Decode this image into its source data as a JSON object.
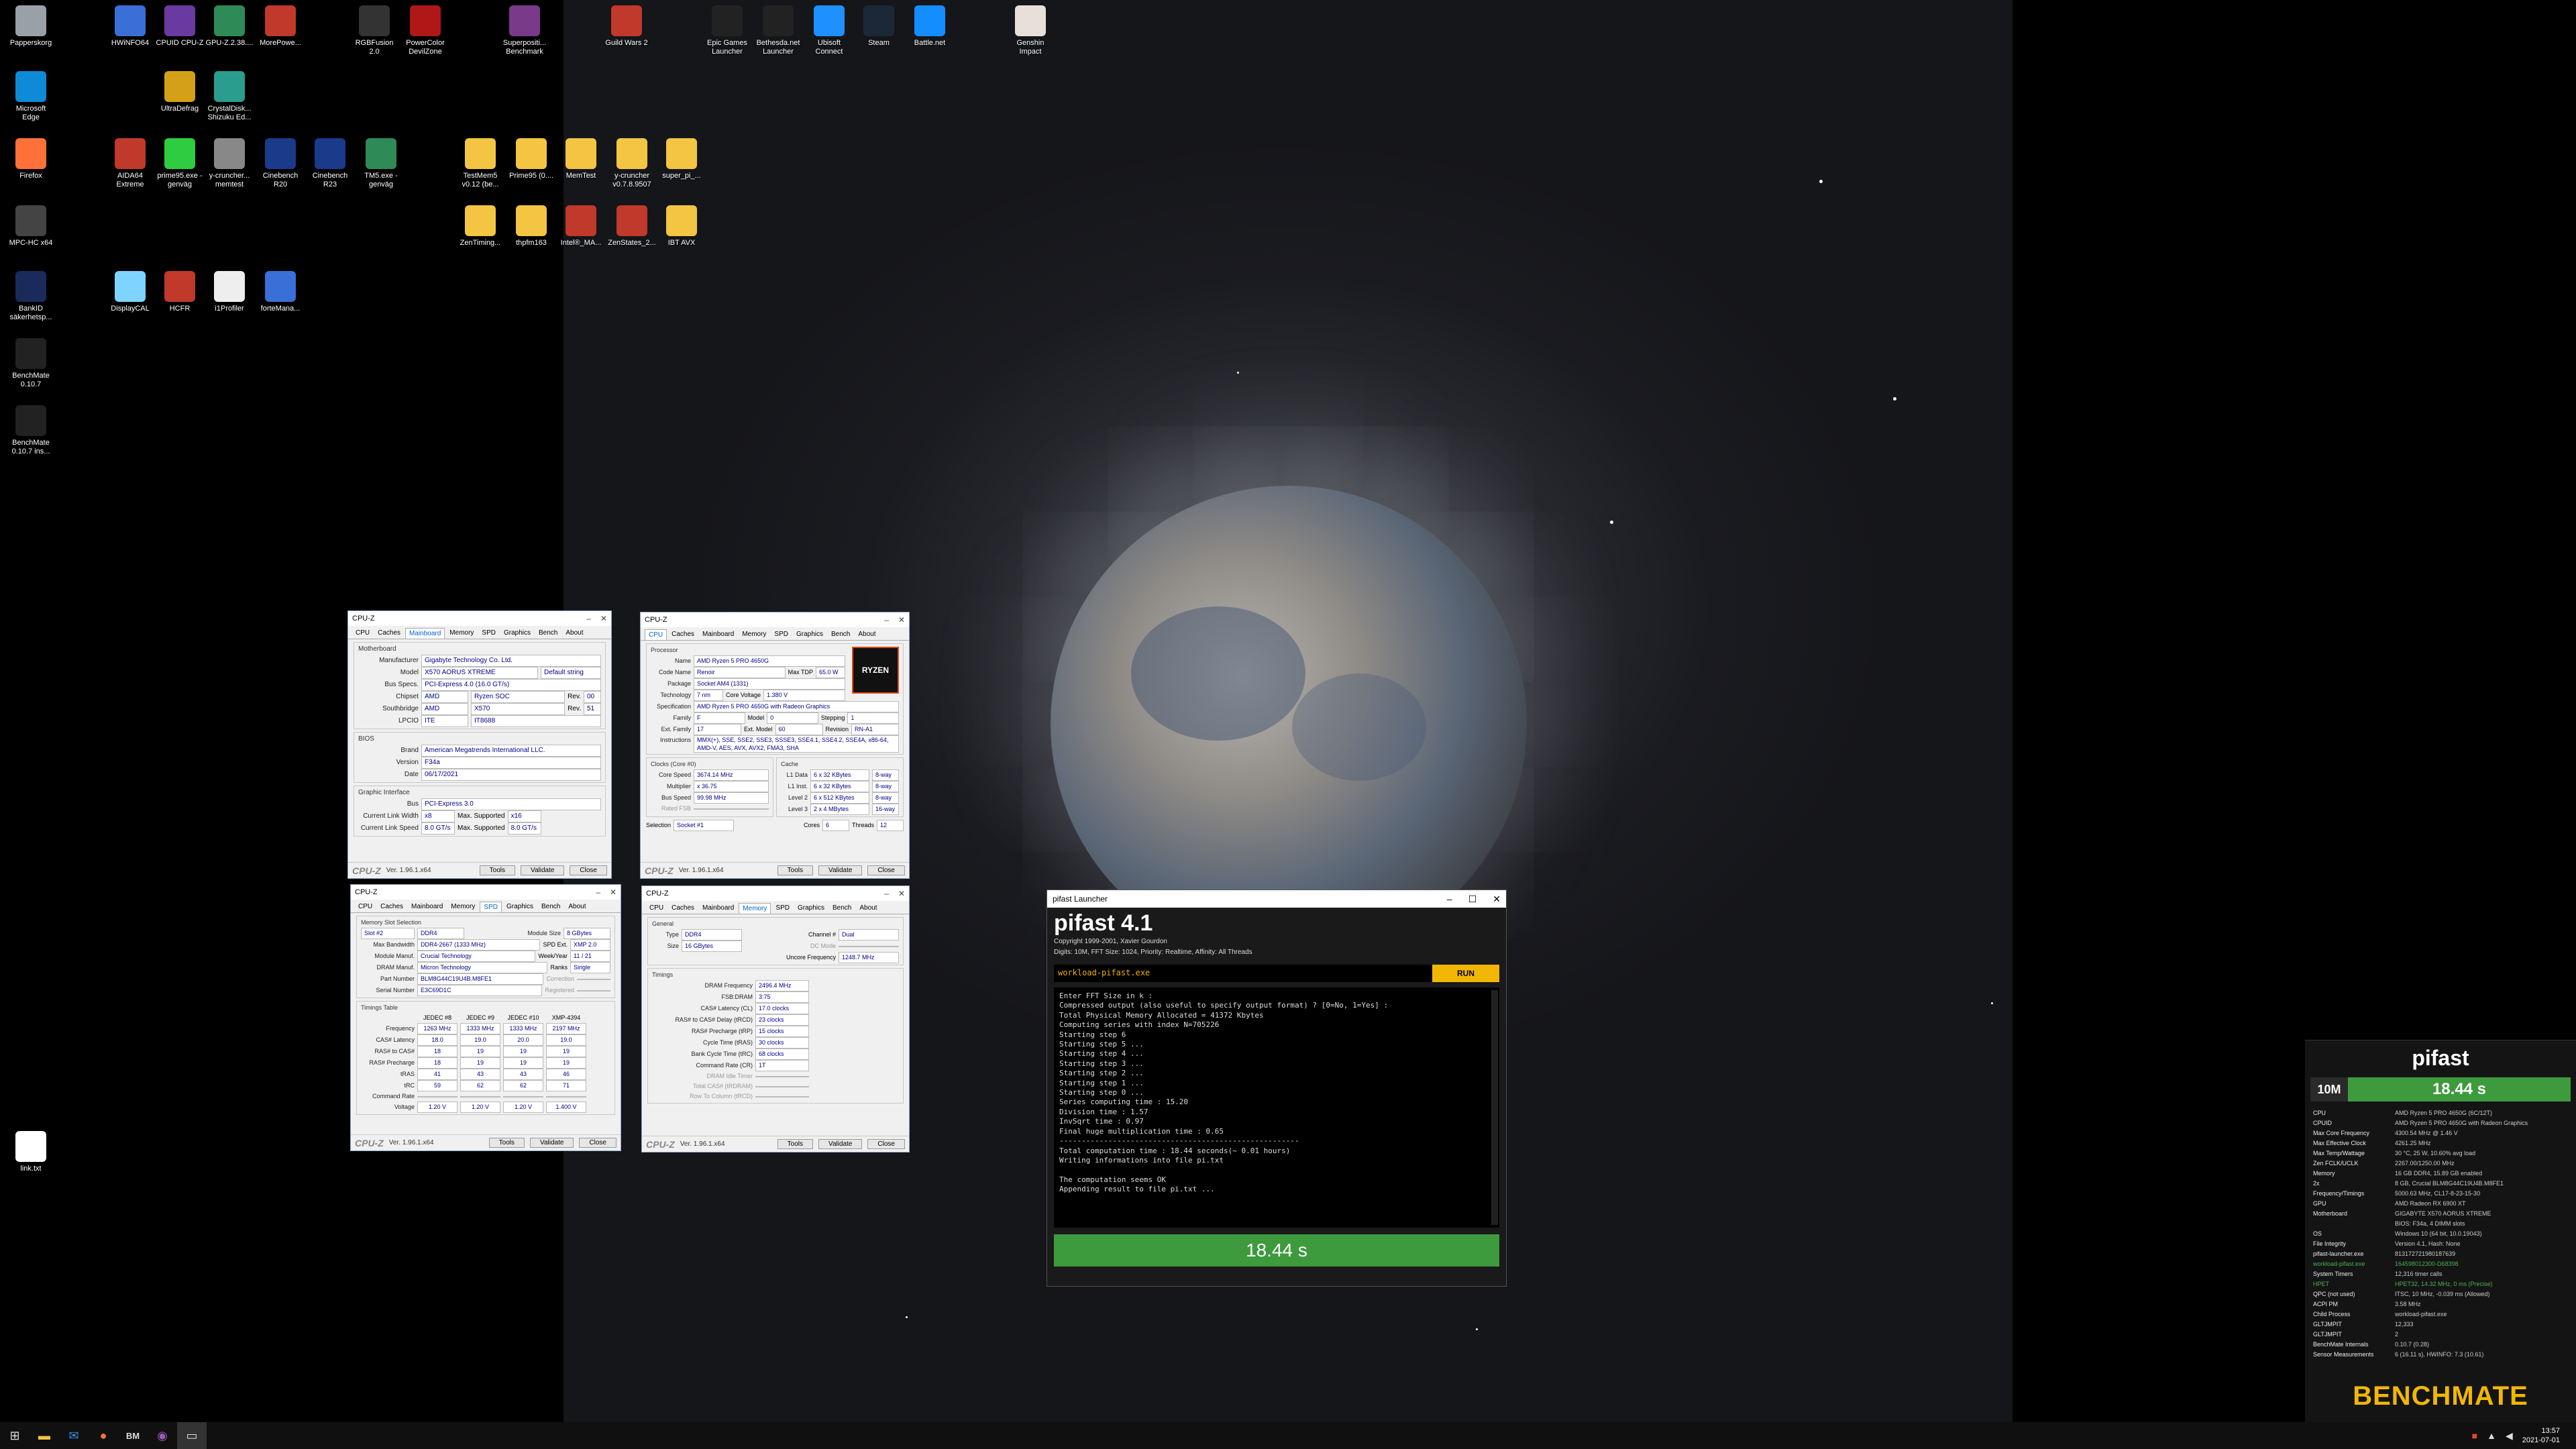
{
  "desktop": {
    "icons": [
      {
        "label": "Papperskorg",
        "color": "#9aa0a8"
      },
      {
        "label": "HWiNFO64",
        "color": "#3a6fd8"
      },
      {
        "label": "CPUID CPU-Z",
        "color": "#6a3aa0"
      },
      {
        "label": "GPU-Z.2.38....",
        "color": "#2e8b57"
      },
      {
        "label": "MorePowe...",
        "color": "#c0392b"
      },
      {
        "label": "RGBFusion 2.0",
        "color": "#333"
      },
      {
        "label": "PowerColor DevilZone",
        "color": "#b01818"
      },
      {
        "label": "Superpositi... Benchmark",
        "color": "#7a3a8a"
      },
      {
        "label": "Guild Wars 2",
        "color": "#c0392b"
      },
      {
        "label": "Epic Games Launcher",
        "color": "#222"
      },
      {
        "label": "Bethesda.net Launcher",
        "color": "#222"
      },
      {
        "label": "Ubisoft Connect",
        "color": "#1e90ff"
      },
      {
        "label": "Steam",
        "color": "#1b2838"
      },
      {
        "label": "Battle.net",
        "color": "#148eff"
      },
      {
        "label": "Genshin Impact",
        "color": "#e8e0d8"
      },
      {
        "label": "Microsoft Edge",
        "color": "#0f8ad6"
      },
      {
        "label": "UltraDefrag",
        "color": "#d4a017"
      },
      {
        "label": "CrystalDisk... Shizuku Ed...",
        "color": "#2a9d8f"
      },
      {
        "label": "Firefox",
        "color": "#ff7139"
      },
      {
        "label": "AIDA64 Extreme",
        "color": "#c0392b"
      },
      {
        "label": "prime95.exe - genväg",
        "color": "#2ecc40"
      },
      {
        "label": "y-cruncher... memtest",
        "color": "#888"
      },
      {
        "label": "Cinebench R20",
        "color": "#1a3a8a"
      },
      {
        "label": "Cinebench R23",
        "color": "#1a3a8a"
      },
      {
        "label": "TM5.exe - genväg",
        "color": "#2e8b57"
      },
      {
        "label": "TestMem5 v0.12 (be...",
        "color": "#f4c542"
      },
      {
        "label": "Prime95 (0....",
        "color": "#f4c542"
      },
      {
        "label": "MemTest",
        "color": "#f4c542"
      },
      {
        "label": "y-cruncher v0.7.8.9507",
        "color": "#f4c542"
      },
      {
        "label": "super_pi_...",
        "color": "#f4c542"
      },
      {
        "label": "MPC-HC x64",
        "color": "#444"
      },
      {
        "label": "ZenTiming...",
        "color": "#f4c542"
      },
      {
        "label": "thpfm163",
        "color": "#f4c542"
      },
      {
        "label": "Intel®_MA...",
        "color": "#c0392b"
      },
      {
        "label": "ZenStates_2...",
        "color": "#c0392b"
      },
      {
        "label": "IBT AVX",
        "color": "#f4c542"
      },
      {
        "label": "BankID säkerhetsp...",
        "color": "#1a2a5a"
      },
      {
        "label": "DisplayCAL",
        "color": "#7fd4ff"
      },
      {
        "label": "HCFR",
        "color": "#c0392b"
      },
      {
        "label": "i1Profiler",
        "color": "#eee"
      },
      {
        "label": "forteMana...",
        "color": "#3a6fd8"
      },
      {
        "label": "BenchMate 0.10.7",
        "color": "#222"
      },
      {
        "label": "BenchMate 0.10.7 ins...",
        "color": "#222"
      },
      {
        "label": "link.txt",
        "color": "#fff"
      }
    ]
  },
  "cpuz_mb": {
    "title": "CPU-Z",
    "tabs": [
      "CPU",
      "Caches",
      "Mainboard",
      "Memory",
      "SPD",
      "Graphics",
      "Bench",
      "About"
    ],
    "group_mb": "Motherboard",
    "manufacturer_k": "Manufacturer",
    "manufacturer": "Gigabyte Technology Co. Ltd.",
    "model_k": "Model",
    "model": "X570 AORUS XTREME",
    "model2": "Default string",
    "busspecs_k": "Bus Specs.",
    "busspecs": "PCI-Express 4.0 (16.0 GT/s)",
    "chipset_k": "Chipset",
    "chipset_a": "AMD",
    "chipset_b": "Ryzen SOC",
    "chipset_rev": "00",
    "south_k": "Southbridge",
    "south_a": "AMD",
    "south_b": "X570",
    "south_rev": "51",
    "lpcio_k": "LPCIO",
    "lpcio_a": "ITE",
    "lpcio_b": "IT8688",
    "group_bios": "BIOS",
    "brand_k": "Brand",
    "brand": "American Megatrends International LLC.",
    "version_k": "Version",
    "version": "F34a",
    "date_k": "Date",
    "date": "06/17/2021",
    "group_gi": "Graphic Interface",
    "bus_k": "Bus",
    "bus": "PCI-Express 3.0",
    "clw_k": "Current Link Width",
    "clw": "x8",
    "msup_k": "Max. Supported",
    "msup": "x16",
    "cls_k": "Current Link Speed",
    "cls": "8.0 GT/s",
    "msup2": "8.0 GT/s",
    "rev_label": "Rev.",
    "logo": "CPU-Z",
    "ver": "Ver. 1.96.1.x64",
    "tools": "Tools",
    "validate": "Validate",
    "close": "Close"
  },
  "cpuz_cpu": {
    "title": "CPU-Z",
    "tabs": [
      "CPU",
      "Caches",
      "Mainboard",
      "Memory",
      "SPD",
      "Graphics",
      "Bench",
      "About"
    ],
    "group_proc": "Processor",
    "name_k": "Name",
    "name": "AMD Ryzen 5 PRO 4650G",
    "code_k": "Code Name",
    "code": "Renoir",
    "tdp_k": "Max TDP",
    "tdp": "65.0 W",
    "pkg_k": "Package",
    "pkg": "Socket AM4 (1331)",
    "tech_k": "Technology",
    "tech": "7 nm",
    "cv_k": "Core Voltage",
    "cv": "1.380 V",
    "spec_k": "Specification",
    "spec": "AMD Ryzen 5 PRO 4650G with Radeon Graphics",
    "fam_k": "Family",
    "fam": "F",
    "model_k": "Model",
    "model": "0",
    "step_k": "Stepping",
    "step": "1",
    "extfam_k": "Ext. Family",
    "extfam": "17",
    "extmod_k": "Ext. Model",
    "extmod": "60",
    "rev_k": "Revision",
    "rev": "RN-A1",
    "instr_k": "Instructions",
    "instr": "MMX(+), SSE, SSE2, SSE3, SSSE3, SSE4.1, SSE4.2, SSE4A, x86-64, AMD-V, AES, AVX, AVX2, FMA3, SHA",
    "group_clk": "Clocks (Core #0)",
    "cs_k": "Core Speed",
    "cs": "3674.14 MHz",
    "mul_k": "Multiplier",
    "mul": "x 36.75",
    "bus_k": "Bus Speed",
    "bus": "99.98 MHz",
    "fsb_k": "Rated FSB",
    "group_cache": "Cache",
    "l1d_k": "L1 Data",
    "l1d": "6 x 32 KBytes",
    "l1d_w": "8-way",
    "l1i_k": "L1 Inst.",
    "l1i": "6 x 32 KBytes",
    "l1i_w": "8-way",
    "l2_k": "Level 2",
    "l2": "6 x 512 KBytes",
    "l2_w": "8-way",
    "l3_k": "Level 3",
    "l3": "2 x 4 MBytes",
    "l3_w": "16-way",
    "sel_k": "Selection",
    "sel": "Socket #1",
    "cores_k": "Cores",
    "cores": "6",
    "threads_k": "Threads",
    "threads": "12",
    "badge": "RYZEN",
    "logo": "CPU-Z",
    "ver": "Ver. 1.96.1.x64",
    "tools": "Tools",
    "validate": "Validate",
    "close": "Close"
  },
  "cpuz_spd": {
    "title": "CPU-Z",
    "tabs": [
      "CPU",
      "Caches",
      "Mainboard",
      "Memory",
      "SPD",
      "Graphics",
      "Bench",
      "About"
    ],
    "group": "Memory Slot Selection",
    "slot": "Slot #2",
    "type": "DDR4",
    "msize_k": "Module Size",
    "msize": "8 GBytes",
    "mbw_k": "Max Bandwidth",
    "mbw": "DDR4-2667 (1333 MHz)",
    "spdext_k": "SPD Ext.",
    "spdext": "XMP 2.0",
    "manuf_k": "Module Manuf.",
    "manuf": "Crucial Technology",
    "wy_k": "Week/Year",
    "wy": "11 / 21",
    "dram_k": "DRAM Manuf.",
    "dram": "Micron Technology",
    "ranks_k": "Ranks",
    "ranks": "Single",
    "pn_k": "Part Number",
    "pn": "BLM8G44C19U4B.M8FE1",
    "corr_k": "Correction",
    "sn_k": "Serial Number",
    "sn": "E3C69D1C",
    "reg_k": "Registered",
    "tt": "Timings Table",
    "cols": [
      "JEDEC #8",
      "JEDEC #9",
      "JEDEC #10",
      "XMP-4394"
    ],
    "rows": [
      [
        "Frequency",
        "1263 MHz",
        "1333 MHz",
        "1333 MHz",
        "2197 MHz"
      ],
      [
        "CAS# Latency",
        "18.0",
        "19.0",
        "20.0",
        "19.0"
      ],
      [
        "RAS# to CAS#",
        "18",
        "19",
        "19",
        "19"
      ],
      [
        "RAS# Precharge",
        "18",
        "19",
        "19",
        "19"
      ],
      [
        "tRAS",
        "41",
        "43",
        "43",
        "46"
      ],
      [
        "tRC",
        "59",
        "62",
        "62",
        "71"
      ],
      [
        "Command Rate",
        "",
        "",
        "",
        ""
      ],
      [
        "Voltage",
        "1.20 V",
        "1.20 V",
        "1.20 V",
        "1.400 V"
      ]
    ],
    "logo": "CPU-Z",
    "ver": "Ver. 1.96.1.x64",
    "tools": "Tools",
    "validate": "Validate",
    "close": "Close"
  },
  "cpuz_mem": {
    "title": "CPU-Z",
    "tabs": [
      "CPU",
      "Caches",
      "Mainboard",
      "Memory",
      "SPD",
      "Graphics",
      "Bench",
      "About"
    ],
    "group_gen": "General",
    "type_k": "Type",
    "type": "DDR4",
    "ch_k": "Channel #",
    "ch": "Dual",
    "size_k": "Size",
    "size": "16 GBytes",
    "dc_k": "DC Mode",
    "uf_k": "Uncore Frequency",
    "uf": "1248.7 MHz",
    "group_t": "Timings",
    "rows": [
      [
        "DRAM Frequency",
        "2496.4 MHz"
      ],
      [
        "FSB:DRAM",
        "3:75"
      ],
      [
        "CAS# Latency (CL)",
        "17.0 clocks"
      ],
      [
        "RAS# to CAS# Delay (tRCD)",
        "23 clocks"
      ],
      [
        "RAS# Precharge (tRP)",
        "15 clocks"
      ],
      [
        "Cycle Time (tRAS)",
        "30 clocks"
      ],
      [
        "Bank Cycle Time (tRC)",
        "68 clocks"
      ],
      [
        "Command Rate (CR)",
        "1T"
      ],
      [
        "DRAM Idle Timer",
        ""
      ],
      [
        "Total CAS# (tRDRAM)",
        ""
      ],
      [
        "Row To Column (tRCD)",
        ""
      ]
    ],
    "logo": "CPU-Z",
    "ver": "Ver. 1.96.1.x64",
    "tools": "Tools",
    "validate": "Validate",
    "close": "Close"
  },
  "pifast": {
    "title": "pifast Launcher",
    "heading": "pifast 4.1",
    "copy1": "Copyright 1999-2001, Xavier Gourdon",
    "copy2": "Digits: 10M, FFT Size: 1024, Priority: Realtime, Affinity: All Threads",
    "cmd": "workload-pifast.exe",
    "run": "RUN",
    "console": "Enter FFT Size in k :\nCompressed output (also useful to specify output format) ? [0=No, 1=Yes] :\nTotal Physical Memory Allocated = 41372 Kbytes\nComputing series with index N=705226\nStarting step 6\nStarting step 5 ...\nStarting step 4 ...\nStarting step 3 ...\nStarting step 2 ...\nStarting step 1 ...\nStarting step 0 ...\nSeries computing time : 15.20\nDivision time : 1.57\nInvSqrt time : 0.97\nFinal huge multiplication time : 0.65\n------------------------------------------------------\nTotal computation time : 18.44 seconds(~ 0.01 hours)\nWriting informations into file pi.txt\n\nThe computation seems OK\nAppending result to file pi.txt ...",
    "result": "18.44 s"
  },
  "benchmate": {
    "title": "pifast",
    "digits": "10M",
    "time": "18.44 s",
    "rows": [
      [
        "CPU",
        "AMD Ryzen 5 PRO 4650G (6C/12T)",
        false
      ],
      [
        "CPUID",
        "AMD Ryzen 5 PRO 4650G with Radeon Graphics",
        false
      ],
      [
        "Max Core Frequency",
        "4300.54 MHz @ 1.46 V",
        false
      ],
      [
        "Max Effective Clock",
        "4261.25 MHz",
        false
      ],
      [
        "Max Temp/Wattage",
        "30 °C, 25 W, 10.60% avg load",
        false
      ],
      [
        "Zen FCLK/UCLK",
        "2267.00/1250.00 MHz",
        false
      ],
      [
        "Memory",
        "16 GB DDR4, 15.89 GB enabled",
        false
      ],
      [
        "2x",
        "8 GB, Crucial BLM8G44C19U4B.M8FE1",
        false
      ],
      [
        "Frequency/Timings",
        "5000.63 MHz, CL17-8-23-15-30",
        false
      ],
      [
        "GPU",
        "AMD Radeon RX 6900 XT",
        false
      ],
      [
        "Motherboard",
        "GIGABYTE X570 AORUS XTREME",
        false
      ],
      [
        "",
        "BIOS: F34a, 4 DIMM slots",
        false
      ],
      [
        "OS",
        "Windows 10 (64 bit, 10.0.19043)",
        false
      ],
      [
        "File Integrity",
        "Version 4.1, Hash: None",
        false
      ],
      [
        "pifast-launcher.exe",
        "813172721980187639",
        false
      ],
      [
        "workload-pifast.exe",
        "164598012300-D68398",
        true
      ],
      [
        "System Timers",
        "12,316 timer calls",
        false
      ],
      [
        "HPET",
        "HPET32, 14.32 MHz, 0 ms (Precise)",
        true
      ],
      [
        "QPC (not used)",
        "ITSC, 10 MHz, -0.039 ms (Allowed)",
        false
      ],
      [
        "ACPI PM",
        "3.58 MHz",
        false
      ],
      [
        "Child Process",
        "workload-pifast.exe",
        false
      ],
      [
        "GLTJMPIT",
        "12,333",
        false
      ],
      [
        "GLTJMPIT",
        "2",
        false
      ],
      [
        "BenchMate Internals",
        "0.10.7 (0.28)",
        false
      ],
      [
        "Sensor Measurements",
        "6 (16.11 s), HWINFO: 7.3 (10.61)",
        false
      ]
    ],
    "brand": "BENCHMATE"
  },
  "taskbar": {
    "clock_time": "13:57",
    "clock_date": "2021-07-01"
  }
}
